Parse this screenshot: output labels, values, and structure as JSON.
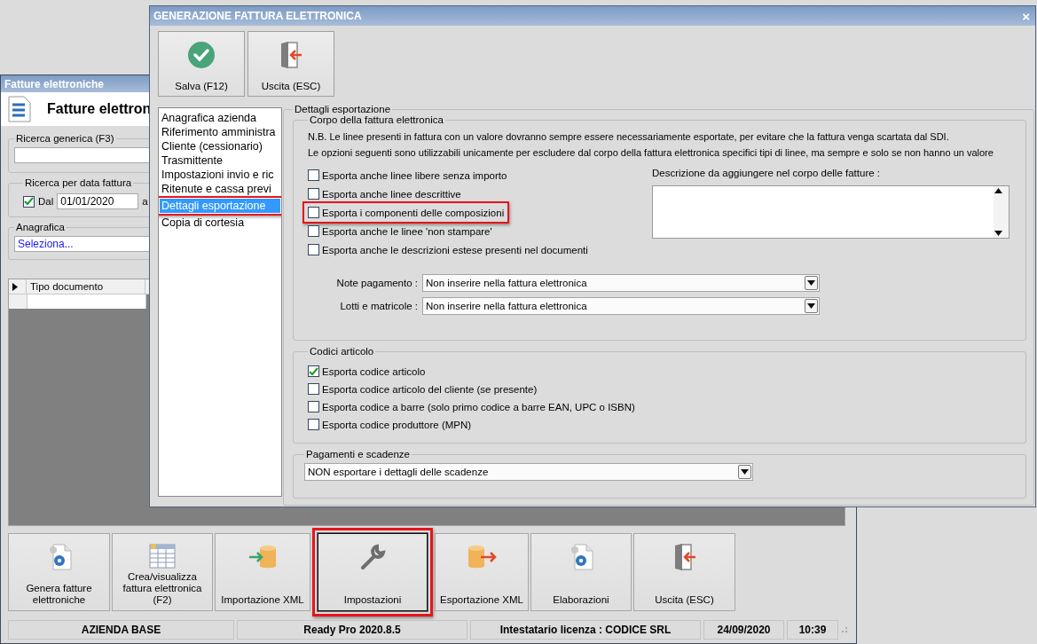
{
  "back_window": {
    "title": "Fatture elettroniche",
    "header": "Fatture elettron",
    "search": {
      "legend": "Ricerca generica (F3)"
    },
    "date_filter": {
      "legend": "Ricerca per data fattura",
      "from_label": "Dal",
      "from_checked": true,
      "from_value": "01/01/2020",
      "to_label": "a"
    },
    "registry": {
      "legend": "Anagrafica",
      "value": "Seleziona..."
    },
    "grid": {
      "columns": [
        "Tipo documento"
      ]
    },
    "buttons": [
      {
        "label": "Genera fatture elettroniche",
        "kind": "generate",
        "highlighted": false
      },
      {
        "label": "Crea/visualizza fattura elettronica (F2)",
        "kind": "view",
        "highlighted": false
      },
      {
        "label": "Importazione XML",
        "kind": "import",
        "highlighted": false
      },
      {
        "label": "Impostazioni",
        "kind": "settings",
        "highlighted": true
      },
      {
        "label": "Esportazione XML",
        "kind": "export",
        "highlighted": false
      },
      {
        "label": "Elaborazioni",
        "kind": "generate",
        "highlighted": false
      },
      {
        "label": "Uscita (ESC)",
        "kind": "exit",
        "highlighted": false
      }
    ],
    "status_bar": [
      "AZIENDA BASE",
      "Ready Pro 2020.8.5",
      "Intestatario licenza : CODICE SRL",
      "24/09/2020",
      "10:39"
    ]
  },
  "dialog": {
    "title": "GENERAZIONE FATTURA ELETTRONICA",
    "close": "×",
    "toolbar": [
      {
        "label": "Salva (F12)",
        "kind": "save"
      },
      {
        "label": "Uscita (ESC)",
        "kind": "exit"
      }
    ],
    "sections": [
      {
        "label": "Anagrafica azienda",
        "selected": false,
        "highlighted": false
      },
      {
        "label": "Riferimento amministra",
        "selected": false,
        "highlighted": false
      },
      {
        "label": "Cliente (cessionario)",
        "selected": false,
        "highlighted": false
      },
      {
        "label": "Trasmittente",
        "selected": false,
        "highlighted": false
      },
      {
        "label": "Impostazioni invio e ric",
        "selected": false,
        "highlighted": false
      },
      {
        "label": "Ritenute e cassa previ",
        "selected": false,
        "highlighted": false
      },
      {
        "label": "Dettagli esportazione",
        "selected": true,
        "highlighted": true
      },
      {
        "label": "Copia di cortesia",
        "selected": false,
        "highlighted": false
      }
    ],
    "details": {
      "legend": "Dettagli esportazione",
      "body": {
        "legend": "Corpo della fattura elettronica",
        "notes": [
          "N.B. Le linee presenti in fattura con un valore dovranno sempre essere necessariamente esportate, per evitare che la fattura venga scartata dal SDI.",
          "Le opzioni seguenti sono utilizzabili unicamente per escludere dal corpo della fattura elettronica specifici tipi di linee, ma sempre e solo se non hanno un valore"
        ],
        "options": [
          {
            "label": "Esporta anche linee libere senza importo",
            "checked": false,
            "highlighted": false
          },
          {
            "label": "Esporta anche linee descrittive",
            "checked": false,
            "highlighted": false
          },
          {
            "label": "Esporta i componenti delle composizioni",
            "checked": false,
            "highlighted": true
          },
          {
            "label": "Esporta anche le linee 'non stampare'",
            "checked": false,
            "highlighted": false
          },
          {
            "label": "Esporta anche le descrizioni estese presenti nel documenti",
            "checked": false,
            "highlighted": false
          }
        ],
        "description_label": "Descrizione da aggiungere nel corpo delle fatture :",
        "selects": [
          {
            "label": "Note pagamento :",
            "value": "Non inserire nella fattura elettronica"
          },
          {
            "label": "Lotti e matricole :",
            "value": "Non inserire nella fattura elettronica"
          }
        ]
      },
      "codes": {
        "legend": "Codici articolo",
        "options": [
          {
            "label": "Esporta codice articolo",
            "checked": true
          },
          {
            "label": "Esporta codice articolo del cliente (se presente)",
            "checked": false
          },
          {
            "label": "Esporta codice a barre (solo primo codice a barre EAN, UPC o ISBN)",
            "checked": false
          },
          {
            "label": "Esporta codice produttore (MPN)",
            "checked": false
          }
        ]
      },
      "payments": {
        "legend": "Pagamenti e scadenze",
        "value": "NON esportare i dettagli delle scadenze"
      }
    }
  }
}
